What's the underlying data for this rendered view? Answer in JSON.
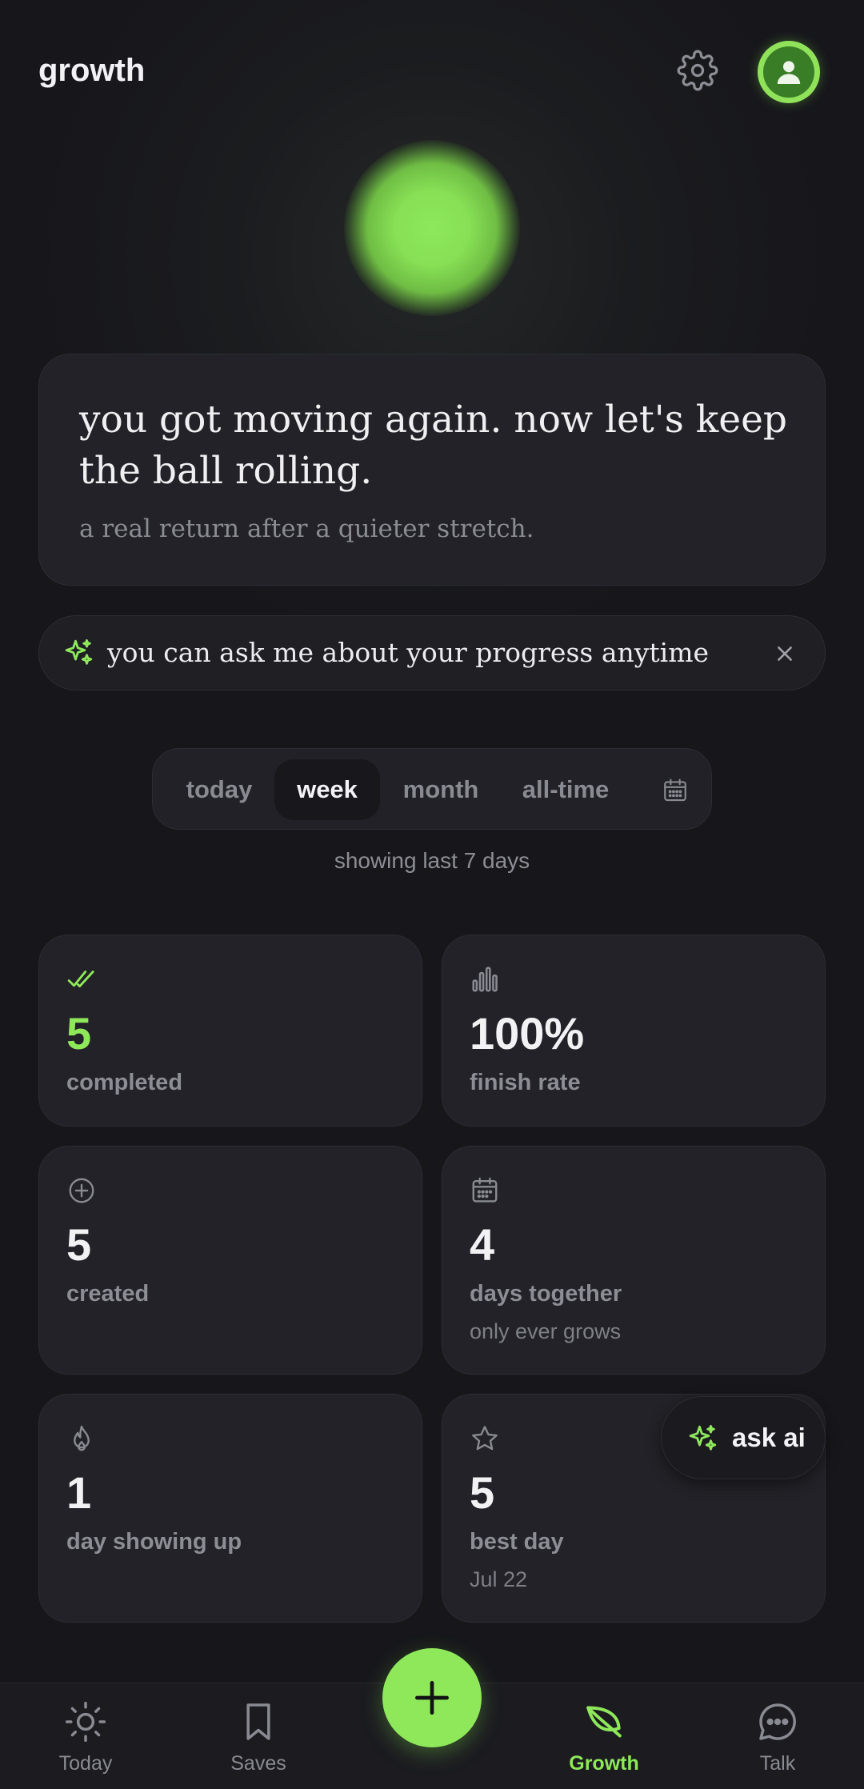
{
  "header": {
    "title": "growth",
    "settings_icon": "gear-icon",
    "avatar_icon": "user-icon"
  },
  "hero": {
    "title": "you got moving again. now let's keep the ball rolling.",
    "subtitle": "a real return after a quieter stretch."
  },
  "tip": {
    "text": "you can ask me about your progress anytime",
    "icon": "sparkles-icon",
    "close_icon": "close-icon"
  },
  "range": {
    "tabs": [
      {
        "label": "today"
      },
      {
        "label": "week"
      },
      {
        "label": "month"
      },
      {
        "label": "all-time"
      }
    ],
    "selected": "week",
    "caption": "showing last 7 days"
  },
  "stats": [
    {
      "icon": "double-check-icon",
      "value": "5",
      "label": "completed"
    },
    {
      "icon": "bar-chart-icon",
      "value": "100%",
      "label": "finish rate"
    },
    {
      "icon": "plus-circle-icon",
      "value": "5",
      "label": "created"
    },
    {
      "icon": "calendar-icon",
      "value": "4",
      "label": "days together",
      "note": "only ever grows"
    },
    {
      "icon": "flame-icon",
      "value": "1",
      "label": "day showing up"
    },
    {
      "icon": "star-icon",
      "value": "5",
      "label": "best day",
      "note": "Jul 22"
    }
  ],
  "ask_ai": {
    "label": "ask ai"
  },
  "nav": {
    "items": [
      {
        "label": "Today",
        "icon": "sun-icon"
      },
      {
        "label": "Saves",
        "icon": "bookmark-icon"
      },
      {
        "label": "Growth",
        "icon": "leaf-icon"
      },
      {
        "label": "Talk",
        "icon": "chat-bubble-icon"
      }
    ],
    "active": "Growth",
    "fab_icon": "plus-icon"
  },
  "colors": {
    "accent": "#8ee85a",
    "background": "#17171b",
    "card": "#222228"
  }
}
